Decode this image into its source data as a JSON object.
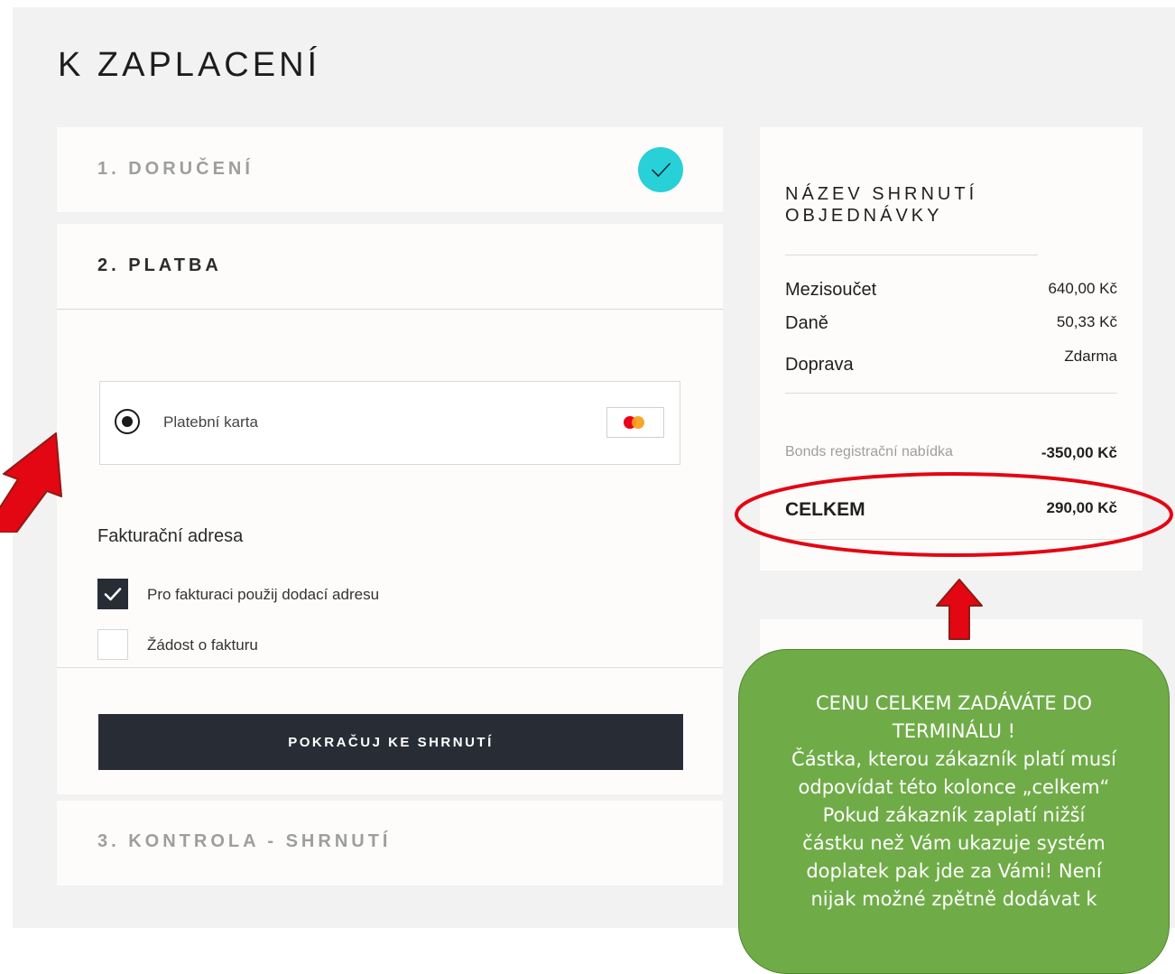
{
  "page": {
    "title": "K ZAPLACENÍ"
  },
  "steps": {
    "delivery": {
      "title": "1. DORUČENÍ",
      "status_icon": "check-circle-icon"
    },
    "payment": {
      "title": "2. PLATBA",
      "method": {
        "label": "Platební karta",
        "selected": true,
        "icon": "mastercard-icon"
      },
      "billing": {
        "heading": "Fakturační adresa",
        "use_delivery_label": "Pro fakturaci použij dodací adresu",
        "use_delivery_checked": true,
        "invoice_request_label": "Žádost o fakturu",
        "invoice_request_checked": false
      },
      "continue_label": "POKRAČUJ KE SHRNUTÍ"
    },
    "review": {
      "title": "3. KONTROLA - SHRNUTÍ"
    }
  },
  "summary": {
    "title": "NÁZEV SHRNUTÍ OBJEDNÁVKY",
    "subtotal": {
      "label": "Mezisoučet",
      "value": "640,00 Kč"
    },
    "tax": {
      "label": "Daně",
      "value": "50,33 Kč"
    },
    "shipping": {
      "label": "Doprava",
      "value": "Zdarma"
    },
    "discount": {
      "label": "Bonds registrační nabídka",
      "value": "-350,00 Kč"
    },
    "total": {
      "label": "CELKEM",
      "value": "290,00 Kč"
    }
  },
  "annotation": {
    "lines": [
      "CENU CELKEM ZADÁVÁTE DO",
      "TERMINÁLU !",
      "Částka, kterou zákazník platí musí",
      "odpovídat této kolonce „celkem“",
      "Pokud zákazník zaplatí nižší",
      "částku než Vám ukazuje systém",
      "doplatek pak jde za Vámi! Není",
      "nijak možné zpětně dodávat k"
    ],
    "ellipse_color": "#e30613",
    "arrow_color": "#e30613",
    "box_color": "#6fac47"
  },
  "colors": {
    "accent_teal": "#28d0d8",
    "dark_button": "#282c35",
    "page_background": "#f2f2f2",
    "card_background": "#fdfcfb"
  }
}
